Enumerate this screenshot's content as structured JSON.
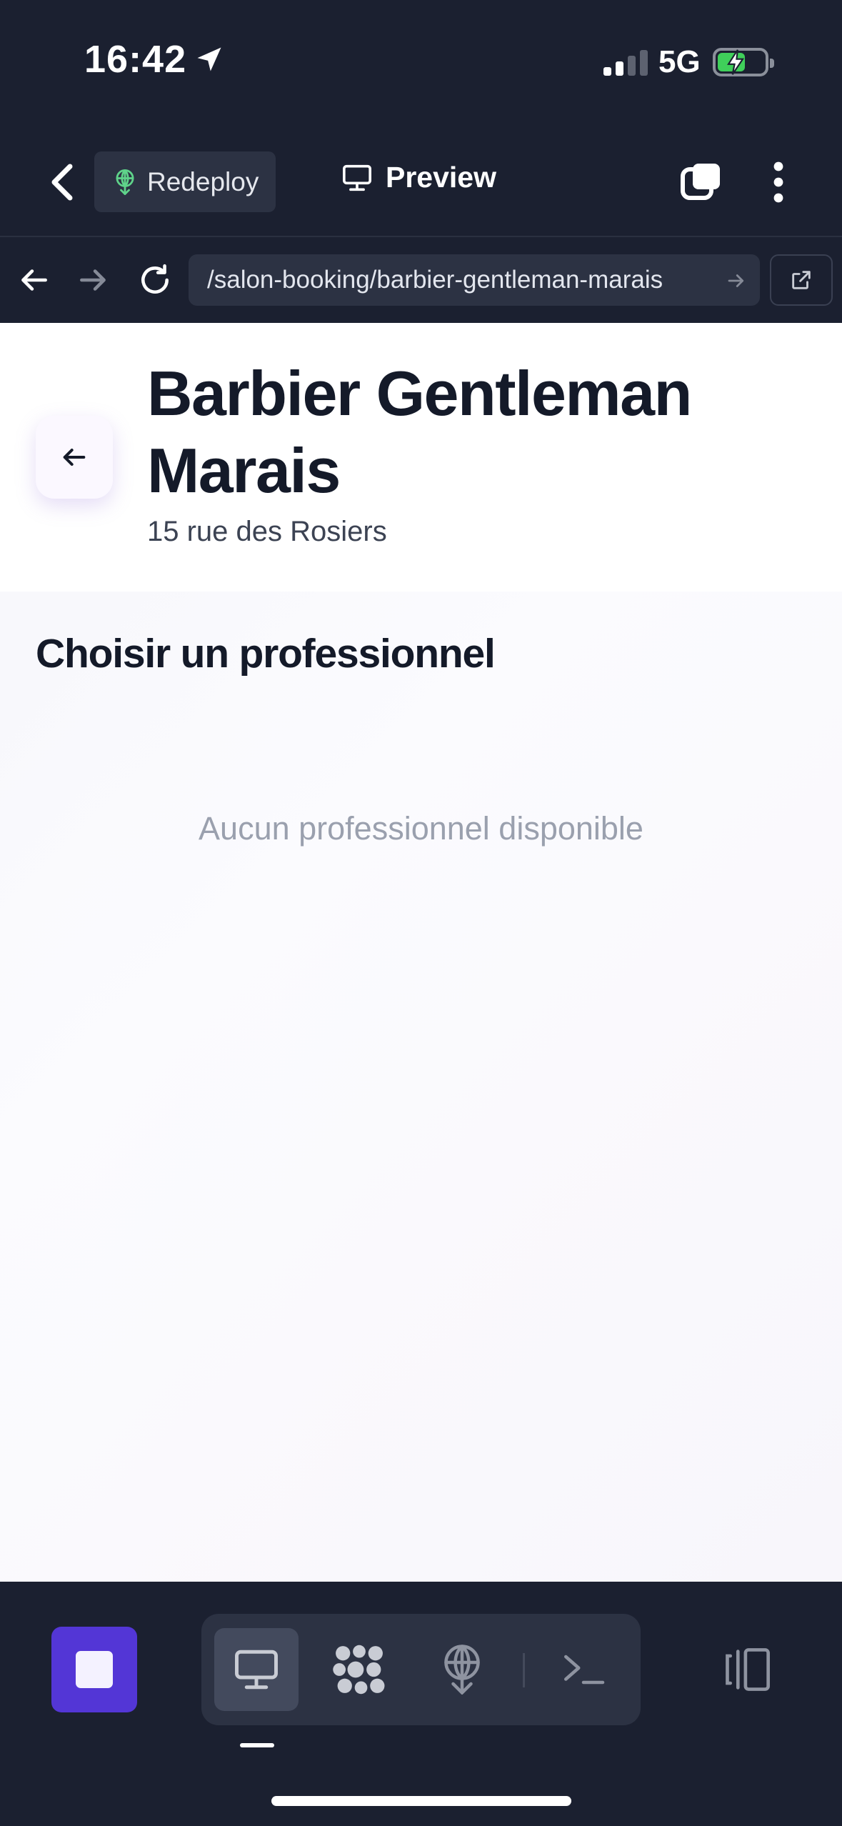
{
  "status_bar": {
    "time": "16:42",
    "network": "5G"
  },
  "toolbar": {
    "redeploy_label": "Redeploy",
    "preview_label": "Preview"
  },
  "browser": {
    "url": "/salon-booking/barbier-gentleman-marais"
  },
  "page": {
    "salon_name": "Barbier Gentleman Marais",
    "salon_address": "15 rue des Rosiers",
    "section_title": "Choisir un professionnel",
    "empty_message": "Aucun professionnel disponible"
  },
  "bottom_bar": {
    "tabs": [
      "preview-tab",
      "integrations-tab",
      "deploy-tab",
      "shell-tab"
    ],
    "active_tab": "preview-tab"
  },
  "colors": {
    "app_bg": "#1b2030",
    "panel": "#2c3243",
    "accent": "#5336d6",
    "battery": "#3fcf5a",
    "redeploy_icon": "#5fd38a"
  }
}
